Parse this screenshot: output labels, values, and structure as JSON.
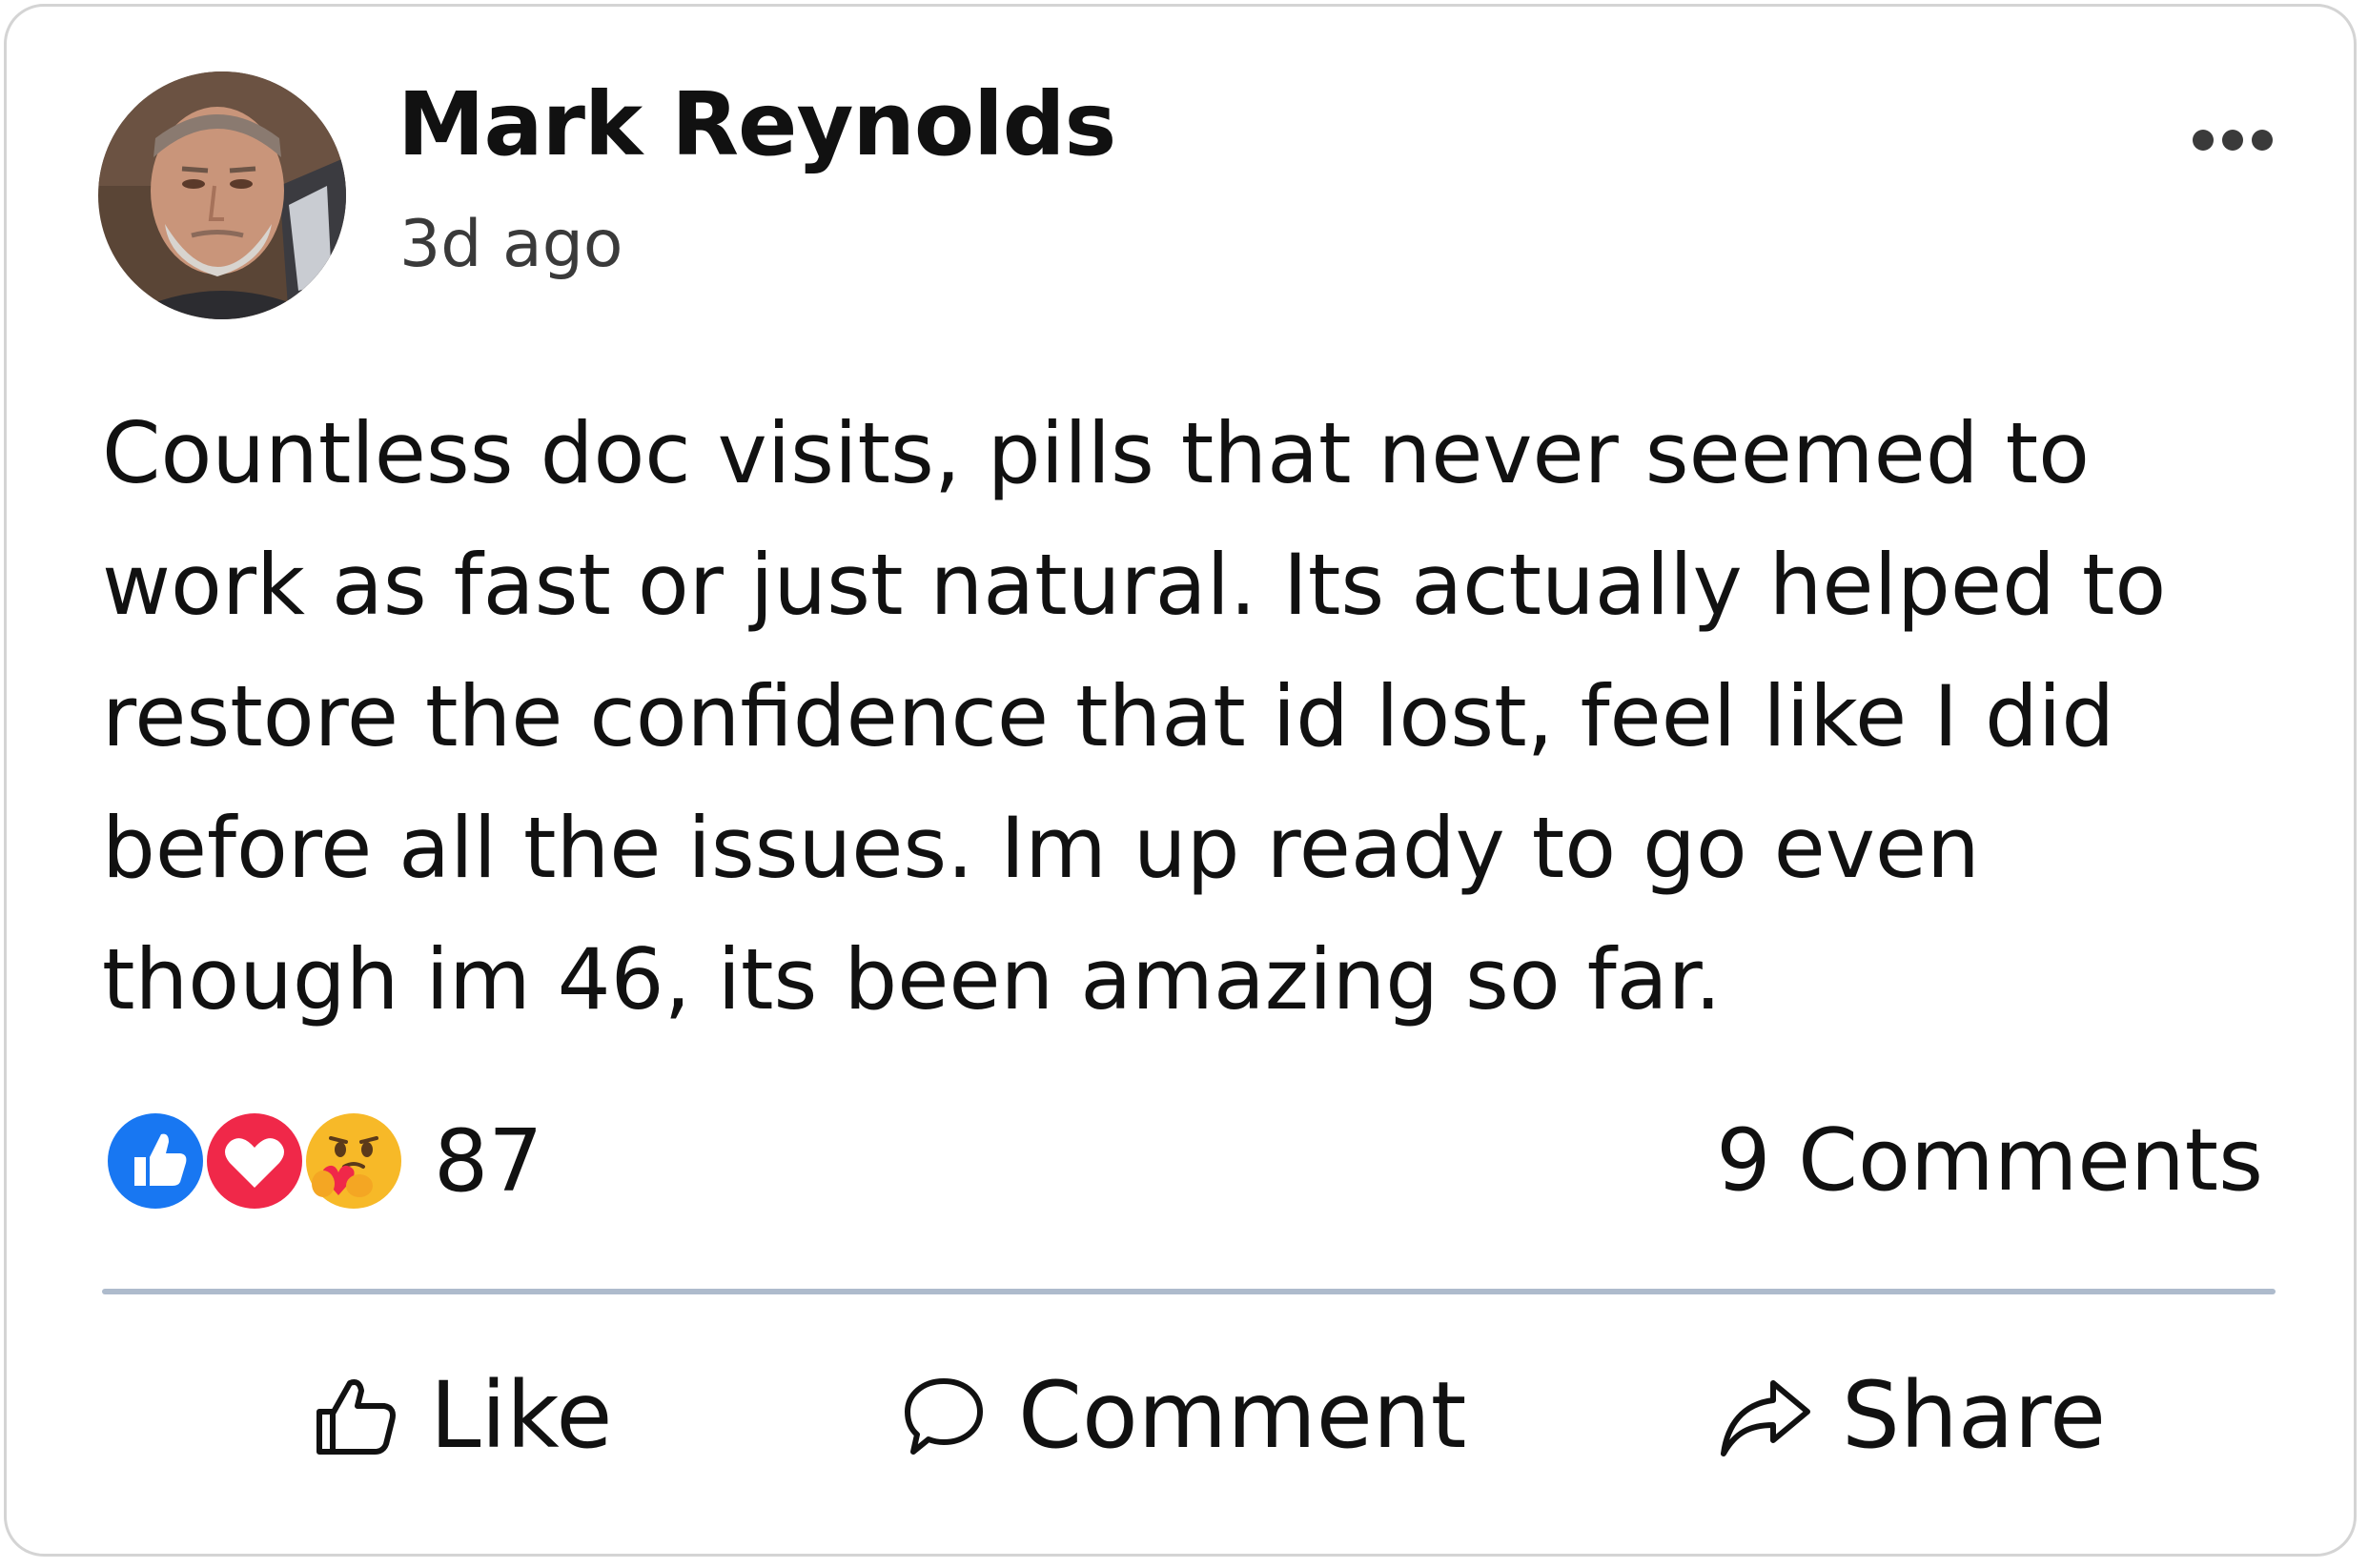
{
  "post": {
    "author": "Mark Reynolds",
    "timestamp": "3d ago",
    "text": "Countless doc visits, pills that never seemed to\nwork as fast or just natural. Its actually helped to\nrestore the confidence that id lost, feel like I did\nbefore all the issues. Im up ready to go even\nthough im 46, its been amazing so far.",
    "more_icon": "more-horizontal-icon"
  },
  "reactions": {
    "icons": [
      "like-reaction-icon",
      "love-reaction-icon",
      "care-reaction-icon"
    ],
    "count": "87",
    "comments": "9 Comments"
  },
  "actions": [
    {
      "label": "Like",
      "icon": "thumbs-up-icon"
    },
    {
      "label": "Comment",
      "icon": "speech-bubble-icon"
    },
    {
      "label": "Share",
      "icon": "share-arrow-icon"
    }
  ],
  "colors": {
    "like_blue": "#1877f2",
    "love_red": "#f02849",
    "care_yellow": "#f7b928",
    "divider": "#aebbcc",
    "card_border": "#d4d4d4"
  }
}
